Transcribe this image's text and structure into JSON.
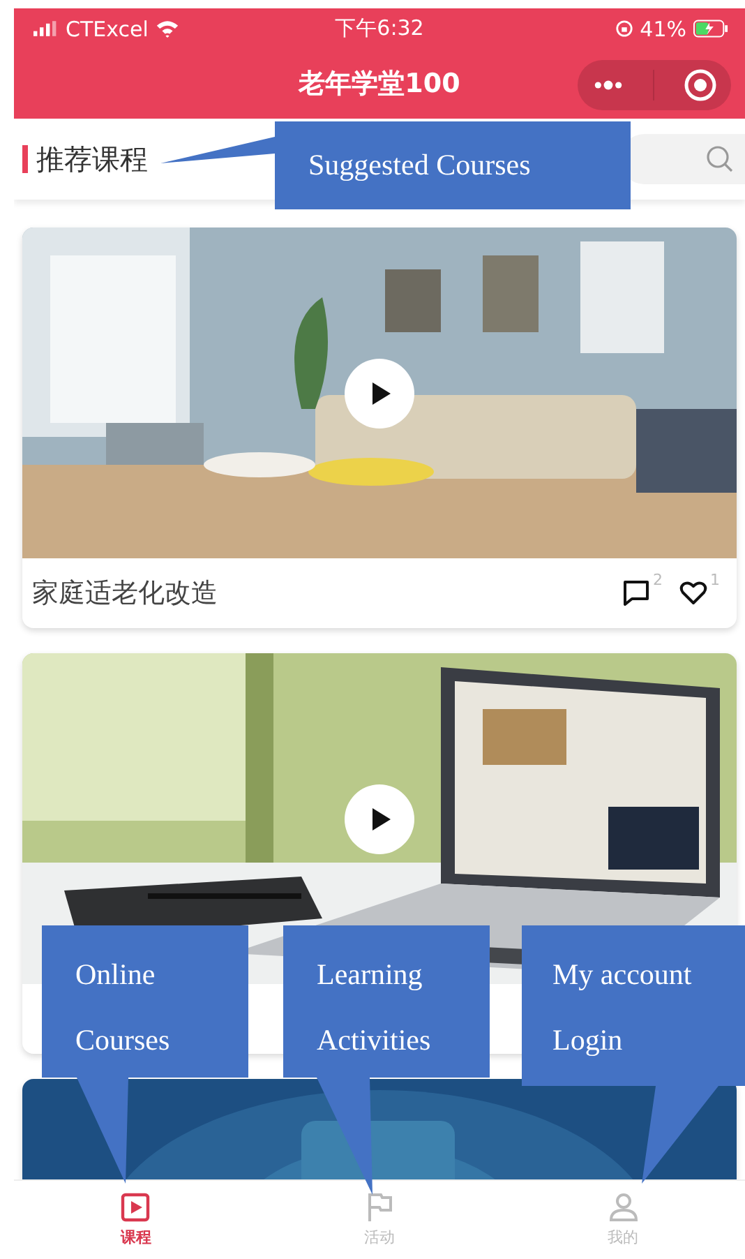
{
  "status_bar": {
    "carrier": "CTExcel",
    "time": "下午6:32",
    "battery": "41%"
  },
  "header": {
    "title": "老年学堂100"
  },
  "section": {
    "title": "推荐课程"
  },
  "courses": [
    {
      "kind": "picture",
      "title": "家庭适老化改造",
      "comments": "2",
      "likes": "1"
    },
    {
      "kind": "picture"
    },
    {
      "kind": "picture"
    }
  ],
  "tabs": [
    {
      "label": "课程",
      "selected": true
    },
    {
      "label": "活动",
      "selected": false
    },
    {
      "label": "我的",
      "selected": false
    }
  ],
  "annotations": [
    {
      "lines": [
        "Suggested Courses"
      ]
    },
    {
      "lines": [
        "Online",
        "Courses"
      ]
    },
    {
      "lines": [
        "Learning",
        "Activities"
      ]
    },
    {
      "lines": [
        "My account",
        "Login"
      ]
    }
  ]
}
